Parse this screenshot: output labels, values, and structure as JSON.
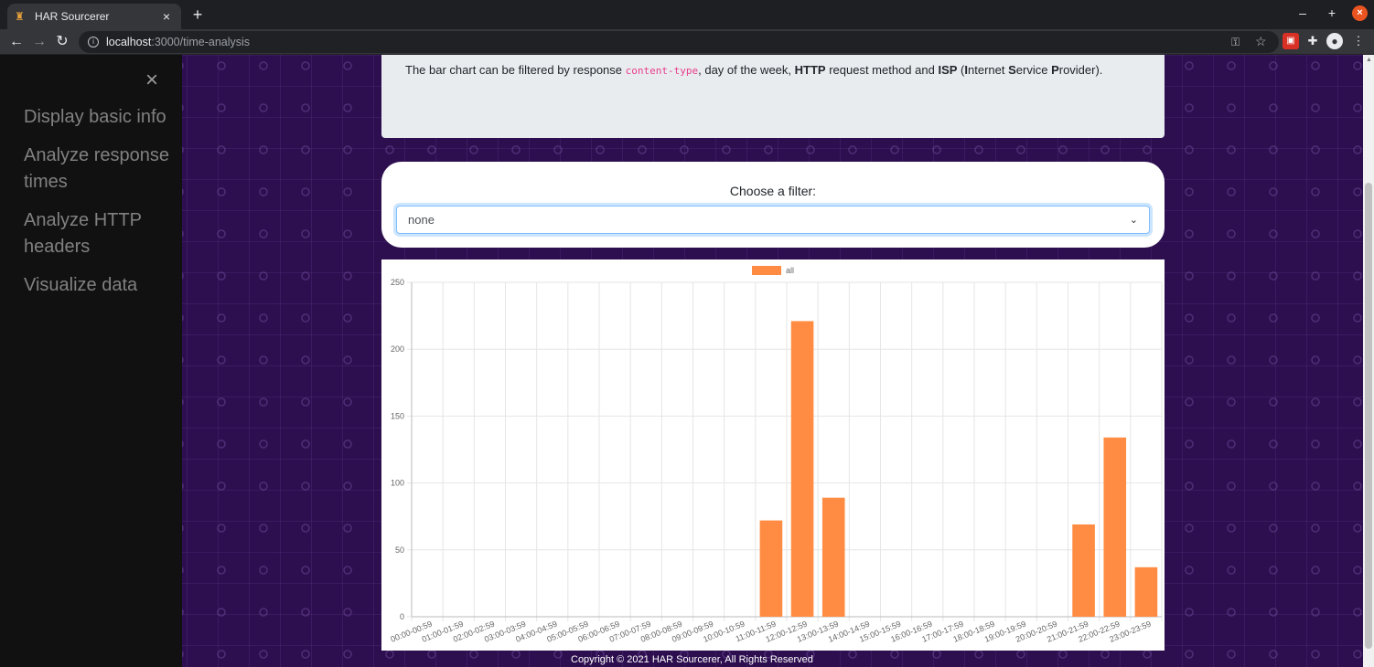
{
  "browser": {
    "tab_title": "HAR Sourcerer",
    "tab_close": "×",
    "new_tab": "+",
    "url_host": "localhost",
    "url_path": ":3000/time-analysis",
    "minimize": "–",
    "maximize": "+",
    "close": "×"
  },
  "sidebar": {
    "close": "×",
    "items": [
      {
        "label": "Display basic info"
      },
      {
        "label": "Analyze response times"
      },
      {
        "label": "Analyze HTTP headers"
      },
      {
        "label": "Visualize data"
      }
    ]
  },
  "info": {
    "t1": "The bar chart can be filtered by response ",
    "code": "content-type",
    "t2": ", day of the week, ",
    "b1": "HTTP",
    "t3": " request method and ",
    "b2": "ISP",
    "t4": " (",
    "b3": "I",
    "t5": "nternet ",
    "b4": "S",
    "t6": "ervice ",
    "b5": "P",
    "t7": "rovider)."
  },
  "filter": {
    "label": "Choose a filter:",
    "selected": "none"
  },
  "footer": "Copyright © 2021 HAR Sourcerer, All Rights Reserved",
  "colors": {
    "bar": "#ff8c42",
    "grid": "#e6e6e6",
    "axis": "#666666"
  },
  "chart_data": {
    "type": "bar",
    "categories": [
      "00:00-00:59",
      "01:00-01:59",
      "02:00-02:59",
      "03:00-03:59",
      "04:00-04:59",
      "05:00-05:59",
      "06:00-06:59",
      "07:00-07:59",
      "08:00-08:59",
      "09:00-09:59",
      "10:00-10:59",
      "11:00-11:59",
      "12:00-12:59",
      "13:00-13:59",
      "14:00-14:59",
      "15:00-15:59",
      "16:00-16:59",
      "17:00-17:59",
      "18:00-18:59",
      "19:00-19:59",
      "20:00-20:59",
      "21:00-21:59",
      "22:00-22:59",
      "23:00-23:59"
    ],
    "series": [
      {
        "name": "all",
        "values": [
          0,
          0,
          0,
          0,
          0,
          0,
          0,
          0,
          0,
          0,
          0,
          72,
          221,
          89,
          0,
          0,
          0,
          0,
          0,
          0,
          0,
          69,
          134,
          37
        ]
      }
    ],
    "ylim": [
      0,
      250
    ],
    "yticks": [
      0,
      50,
      100,
      150,
      200,
      250
    ],
    "grid": true,
    "legend": "top"
  }
}
